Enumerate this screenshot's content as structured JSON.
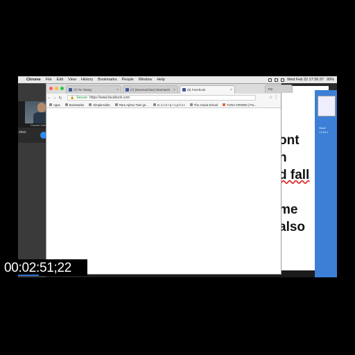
{
  "menubar": {
    "apple": "",
    "app": "Chrome",
    "items": [
      "File",
      "Edit",
      "View",
      "History",
      "Bookmarks",
      "People",
      "Window",
      "Help"
    ],
    "clock": "Wed Feb 22 17:26:37",
    "battery": "99%"
  },
  "call": {
    "label": "Current Call",
    "name": "ches"
  },
  "browser": {
    "tabs": [
      {
        "label": "(7) Tin Tsang"
      },
      {
        "label": "(7) (timemachine) timemachi"
      },
      {
        "label": "(8) Facebook"
      },
      {
        "label": "Tim"
      }
    ],
    "secure_label": "Secure",
    "url": "https://www.facebook.com",
    "bookmarks": [
      "Apps",
      "Bookmarks",
      "SimpleAdder",
      "Rare Aphex Twin ge...",
      "m o n k • p r o p h e t",
      "The Actual School",
      "TUNA CROWN | Fre..."
    ]
  },
  "document": {
    "lines": [
      "ont",
      "n",
      "d fall",
      "",
      "me",
      "also"
    ]
  },
  "side": {
    "thumb_label1": "Short",
    "thumb_label2": "17.24.1"
  },
  "timecode": "00:02:51;22",
  "colors": {
    "facebook": "#3b5998",
    "mic": "#2d8cf0",
    "end_call": "#e23b3b",
    "secure": "#1a8f3c"
  }
}
